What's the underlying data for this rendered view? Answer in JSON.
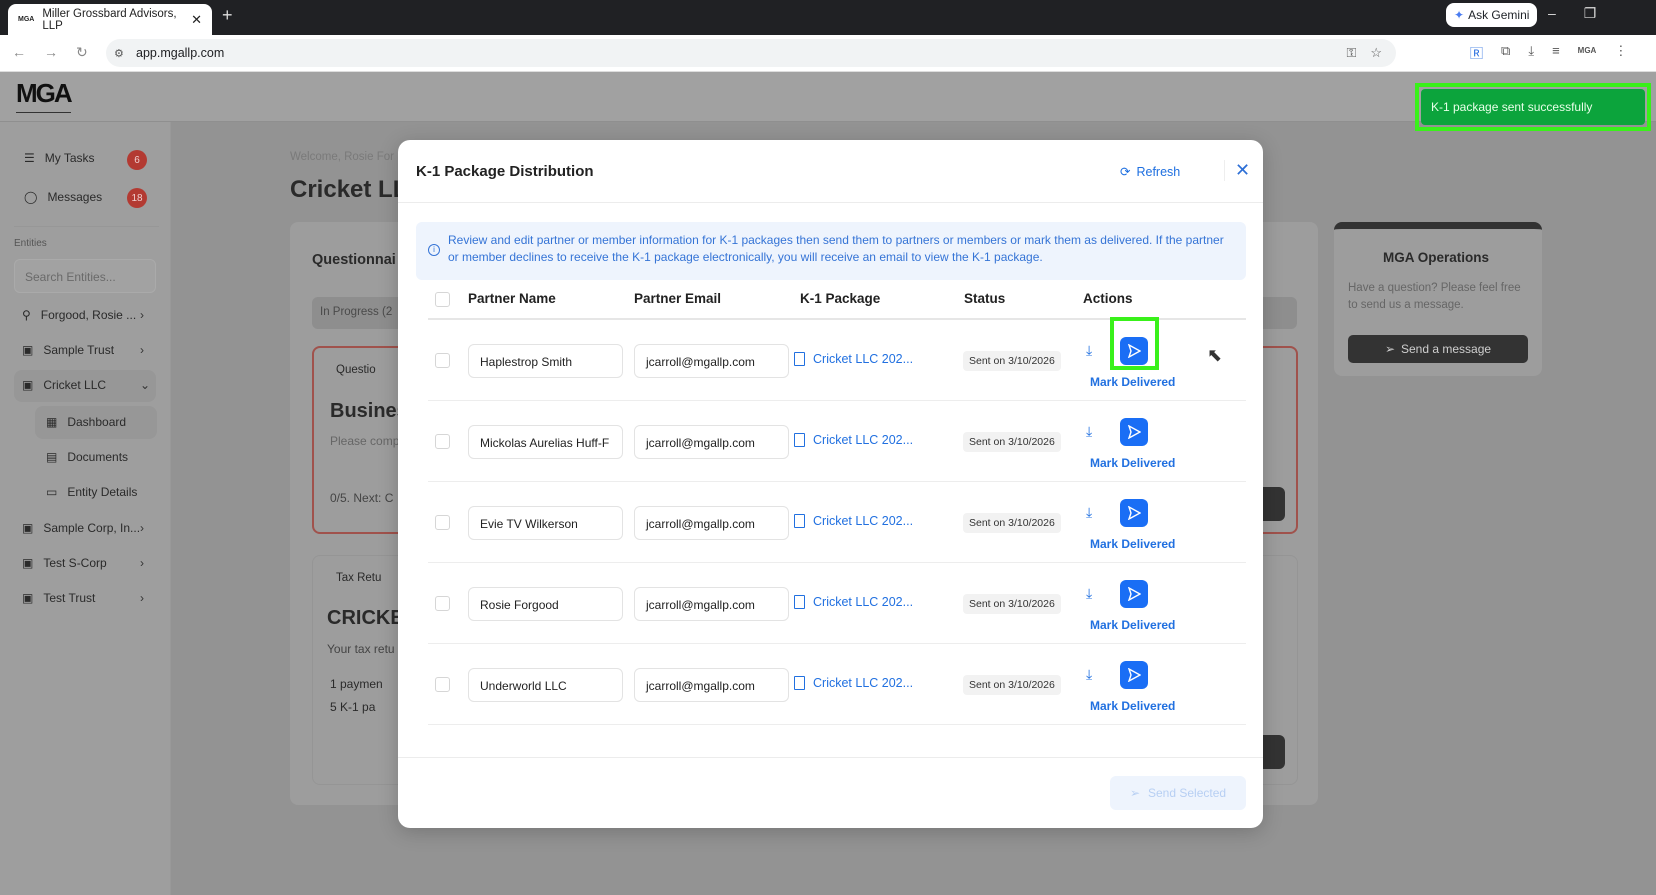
{
  "browser": {
    "tab_title": "Miller Grossbard Advisors, LLP",
    "tab_favicon": "MGA",
    "url": "app.mgallp.com",
    "ask_gemini": "Ask Gemini",
    "ext_label": "MGA"
  },
  "app": {
    "logo": "MGA"
  },
  "sidebar": {
    "my_tasks": "My Tasks",
    "my_tasks_count": "6",
    "messages": "Messages",
    "messages_count": "18",
    "entities_label": "Entities",
    "search_placeholder": "Search Entities...",
    "entities": [
      {
        "label": "Forgood, Rosie ..."
      },
      {
        "label": "Sample Trust"
      },
      {
        "label": "Cricket LLC"
      },
      {
        "label": "Sample Corp, In..."
      },
      {
        "label": "Test S-Corp"
      },
      {
        "label": "Test Trust"
      }
    ],
    "sub_items": [
      {
        "label": "Dashboard"
      },
      {
        "label": "Documents"
      },
      {
        "label": "Entity Details"
      }
    ]
  },
  "background": {
    "welcome": "Welcome, Rosie For",
    "title": "Cricket LL",
    "questionnaire": "Questionnai",
    "in_progress": "In Progress (2",
    "q_badge": "Questio",
    "business": "Busines",
    "please": "Please comp",
    "progress": "0/5. Next: C",
    "tax_badge": "Tax Retu",
    "cricket": "CRICKE",
    "your_tax": "Your tax retu",
    "payment": "1 paymen",
    "k1pa": "5 K-1 pa",
    "ops_title": "MGA Operations",
    "ops_text": "Have a question? Please feel free to send us a message.",
    "send_message": "Send a message"
  },
  "modal": {
    "title": "K-1 Package Distribution",
    "refresh": "Refresh",
    "info": "Review and edit partner or member information for K-1 packages then send them to partners or members or mark them as delivered. If the partner or member declines to receive the K-1 package electronically, you will receive an email to view the K-1 package.",
    "columns": [
      "Partner Name",
      "Partner Email",
      "K-1 Package",
      "Status",
      "Actions"
    ],
    "rows": [
      {
        "name": "Haplestrop Smith",
        "email": "jcarroll@mgallp.com",
        "package": "Cricket LLC 202...",
        "status": "Sent on 3/10/2026",
        "mark": "Mark Delivered"
      },
      {
        "name": "Mickolas Aurelias Huff-F",
        "email": "jcarroll@mgallp.com",
        "package": "Cricket LLC 202...",
        "status": "Sent on 3/10/2026",
        "mark": "Mark Delivered"
      },
      {
        "name": "Evie TV Wilkerson",
        "email": "jcarroll@mgallp.com",
        "package": "Cricket LLC 202...",
        "status": "Sent on 3/10/2026",
        "mark": "Mark Delivered"
      },
      {
        "name": "Rosie Forgood",
        "email": "jcarroll@mgallp.com",
        "package": "Cricket LLC 202...",
        "status": "Sent on 3/10/2026",
        "mark": "Mark Delivered"
      },
      {
        "name": "Underworld LLC",
        "email": "jcarroll@mgallp.com",
        "package": "Cricket LLC 202...",
        "status": "Sent on 3/10/2026",
        "mark": "Mark Delivered"
      }
    ],
    "send_selected": "Send Selected"
  },
  "toast": {
    "message": "K-1 package sent successfully",
    "color": "#0ca43c"
  }
}
